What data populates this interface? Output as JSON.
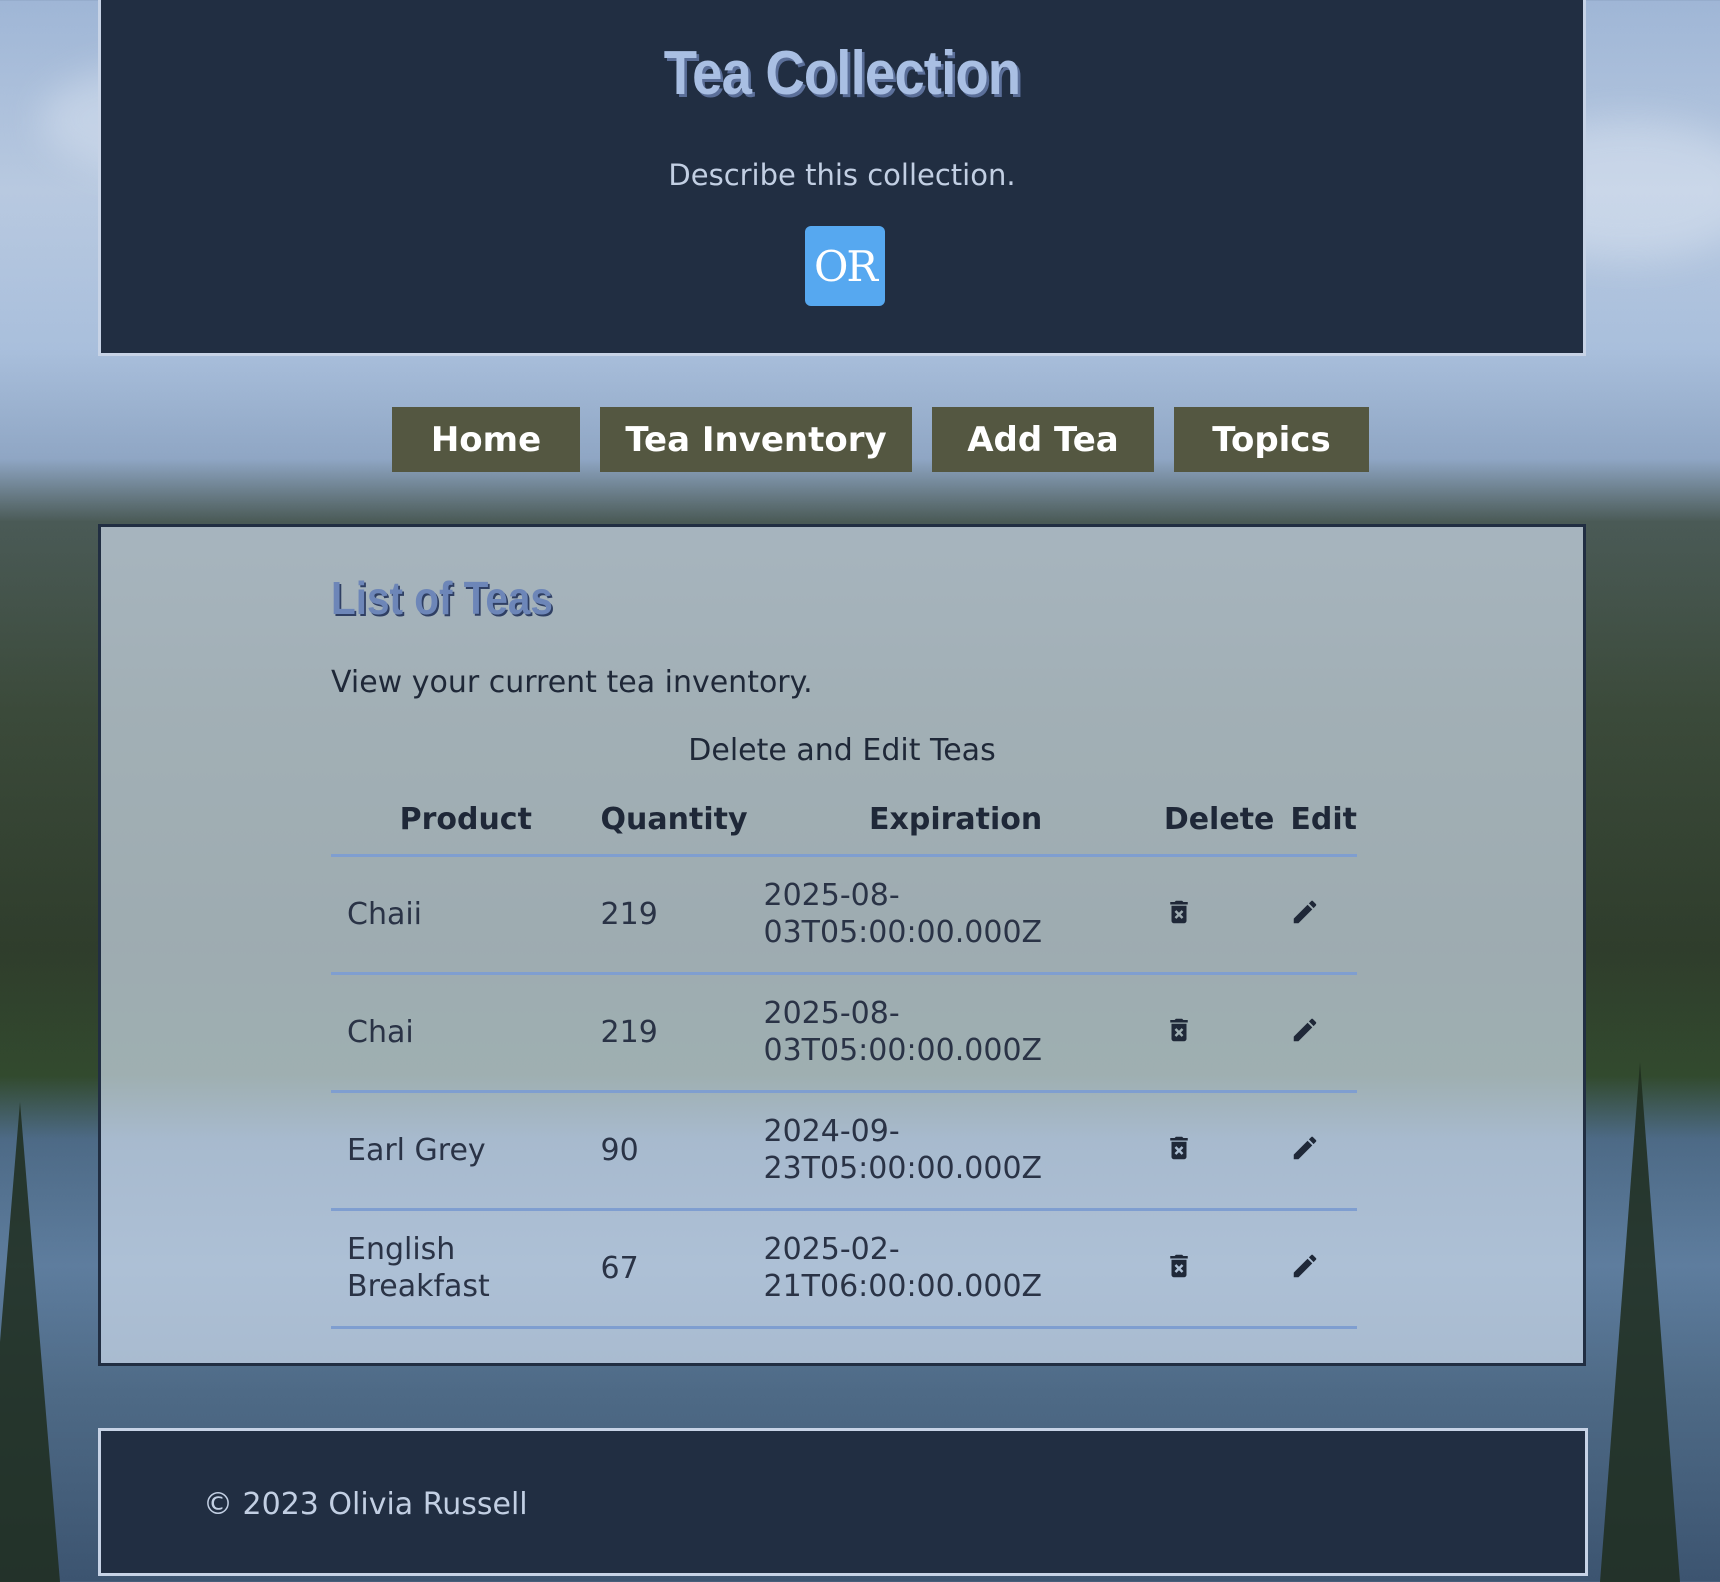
{
  "header": {
    "title": "Tea Collection",
    "description": "Describe this collection.",
    "logo_text": "OR"
  },
  "nav": {
    "items": [
      {
        "label": "Home"
      },
      {
        "label": "Tea Inventory"
      },
      {
        "label": "Add Tea"
      },
      {
        "label": "Topics"
      }
    ]
  },
  "main": {
    "title": "List of Teas",
    "description": "View your current tea inventory.",
    "table": {
      "caption": "Delete and Edit Teas",
      "headers": [
        "Product",
        "Quantity",
        "Expiration",
        "Delete",
        "Edit"
      ],
      "rows": [
        {
          "product": "Chaii",
          "quantity": "219",
          "expiration": "2025-08-03T05:00:00.000Z"
        },
        {
          "product": "Chai",
          "quantity": "219",
          "expiration": "2025-08-03T05:00:00.000Z"
        },
        {
          "product": "Earl Grey",
          "quantity": "90",
          "expiration": "2024-09-23T05:00:00.000Z"
        },
        {
          "product": "English Breakfast",
          "quantity": "67",
          "expiration": "2025-02-21T06:00:00.000Z"
        }
      ]
    }
  },
  "footer": {
    "copyright": "© 2023 Olivia Russell"
  },
  "icons": {
    "delete": "trash-icon",
    "edit": "pencil-icon"
  },
  "colors": {
    "header_bg": "#212e42",
    "nav_bg": "#545741",
    "logo_bg": "#56a8f0",
    "title": "#a9bfe3",
    "table_rule": "#7f9ed0"
  }
}
